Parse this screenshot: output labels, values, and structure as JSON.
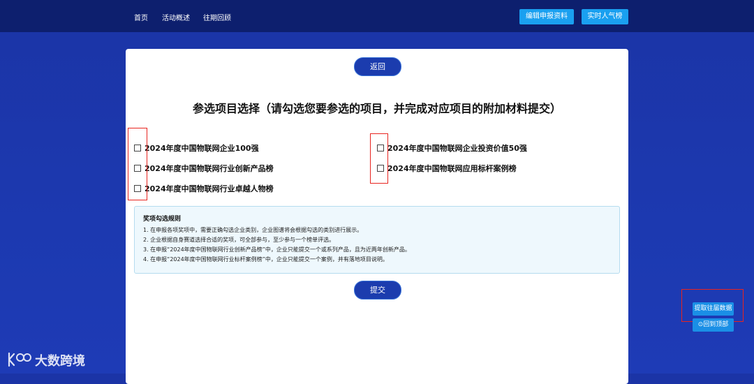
{
  "nav": {
    "home": "首页",
    "overview": "活动概述",
    "review": "往期回顾"
  },
  "top_buttons": {
    "edit": "编辑申报资料",
    "live": "实时人气榜"
  },
  "card": {
    "back_label": "返回",
    "title": "参选项目选择（请勾选您要参选的项目，并完成对应项目的附加材料提交）",
    "options": [
      "2024年度中国物联网企业100强",
      "2024年度中国物联网行业创新产品榜",
      "2024年度中国物联网行业卓越人物榜",
      "2024年度中国物联网企业投资价值50强",
      "2024年度中国物联网应用标杆案例榜"
    ],
    "rules_title": "奖项勾选规则",
    "rules": [
      "1. 在申报各项奖项中，需要正确勾选企业类别，企业图谱将会根据勾选的类别进行展示。",
      "2. 企业根据自身赛道选择合适的奖项，可全部参与，至少参与一个榜单评选。",
      "3. 在申报“2024年度中国物联网行业创新产品榜”中，企业只能提交一个或系列产品，且为近两年创新产品。",
      "4. 在申报“2024年度中国物联网行业标杆案例榜”中，企业只能提交一个案例，并有落地项目说明。"
    ],
    "submit_label": "提交"
  },
  "side": {
    "fetch_label": "提取往届数据",
    "top_label": "⊙回到顶部"
  },
  "watermark": {
    "text": "大数跨境"
  },
  "colors": {
    "background": "#1c39b0",
    "topbar": "#0d1f6e",
    "accent_button": "#1aa0f0",
    "pill_button": "#1b3cae",
    "highlight_box": "#e8241f"
  }
}
